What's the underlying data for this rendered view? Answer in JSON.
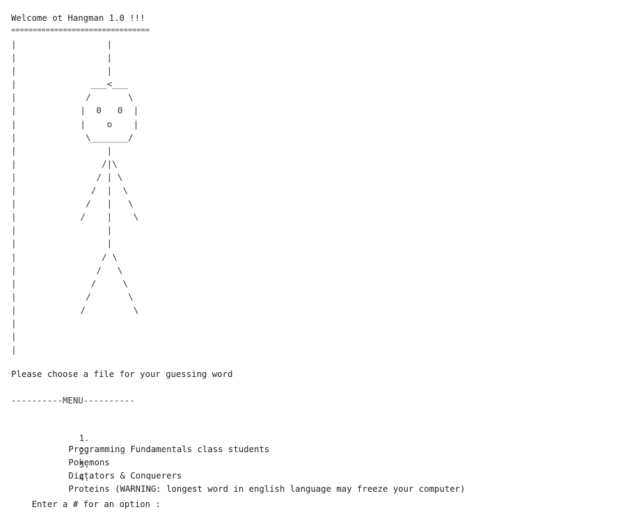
{
  "title": "Welcome ot Hangman 1.0 !!!",
  "underline": "================================",
  "ascii_art": "|                 |\n|                 |\n|                 |\n|              ___<___\n|             /       \\\n|            |  0   0  |\n|            |    o    |\n|             \\_______/\n|                 |\n|                /|\\\n|               / | \\\n|              /  |  \\\n|             /   |   \\\n|            /    |    \\\n|                 |\n|                 |\n|                / \\\n|               /   \\\n|              /     \\\n|             /       \\\n|            /         \\\n|\n|\n|",
  "file_prompt": "Please choose a file for your guessing word",
  "menu_header": "----------MENU----------",
  "menu": [
    {
      "num": "1.",
      "label": "Programming Fundamentals class students"
    },
    {
      "num": "2.",
      "label": "Pokemons"
    },
    {
      "num": "3.",
      "label": "Dictators & Conquerers"
    },
    {
      "num": "4.",
      "label": "Proteins (WARNING: longest word in english language may freeze your computer)"
    }
  ],
  "input_prompt": "Enter a # for an option :"
}
